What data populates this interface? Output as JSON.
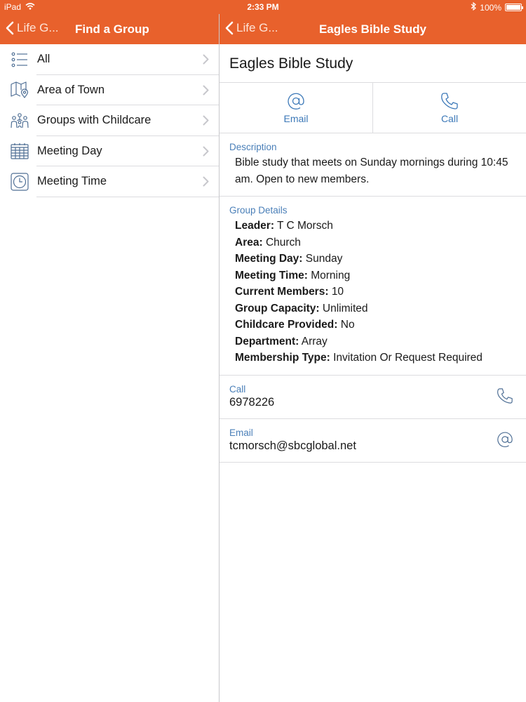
{
  "status_bar": {
    "device": "iPad",
    "time": "2:33 PM",
    "battery_percent": "100%",
    "battery_level": 1.0
  },
  "master_nav": {
    "back_label": "Life G...",
    "title": "Find a Group"
  },
  "detail_nav": {
    "back_label": "Life G...",
    "title": "Eagles Bible Study"
  },
  "menu": {
    "items": [
      {
        "label": "All",
        "icon": "list-icon"
      },
      {
        "label": "Area of Town",
        "icon": "map-icon"
      },
      {
        "label": "Groups with Childcare",
        "icon": "family-icon"
      },
      {
        "label": "Meeting Day",
        "icon": "calendar-icon"
      },
      {
        "label": "Meeting Time",
        "icon": "clock-icon"
      }
    ]
  },
  "detail": {
    "title": "Eagles Bible Study",
    "actions": {
      "email_label": "Email",
      "call_label": "Call"
    },
    "description": {
      "header": "Description",
      "text": "Bible study that meets on Sunday mornings during 10:45 am. Open to new members."
    },
    "group_details": {
      "header": "Group Details",
      "rows": [
        {
          "label": "Leader:",
          "value": "T C Morsch"
        },
        {
          "label": "Area:",
          "value": "Church"
        },
        {
          "label": "Meeting Day:",
          "value": "Sunday"
        },
        {
          "label": "Meeting Time:",
          "value": "Morning"
        },
        {
          "label": "Current Members:",
          "value": "10"
        },
        {
          "label": "Group Capacity:",
          "value": "Unlimited"
        },
        {
          "label": "Childcare Provided:",
          "value": "No"
        },
        {
          "label": "Department:",
          "value": "Array"
        },
        {
          "label": "Membership Type:",
          "value": "Invitation Or Request Required"
        }
      ]
    },
    "call": {
      "label": "Call",
      "value": "6978226"
    },
    "email": {
      "label": "Email",
      "value": "tcmorsch@sbcglobal.net"
    }
  },
  "colors": {
    "accent": "#e8612c",
    "link": "#3d79b8",
    "icon": "#4f6f95"
  }
}
